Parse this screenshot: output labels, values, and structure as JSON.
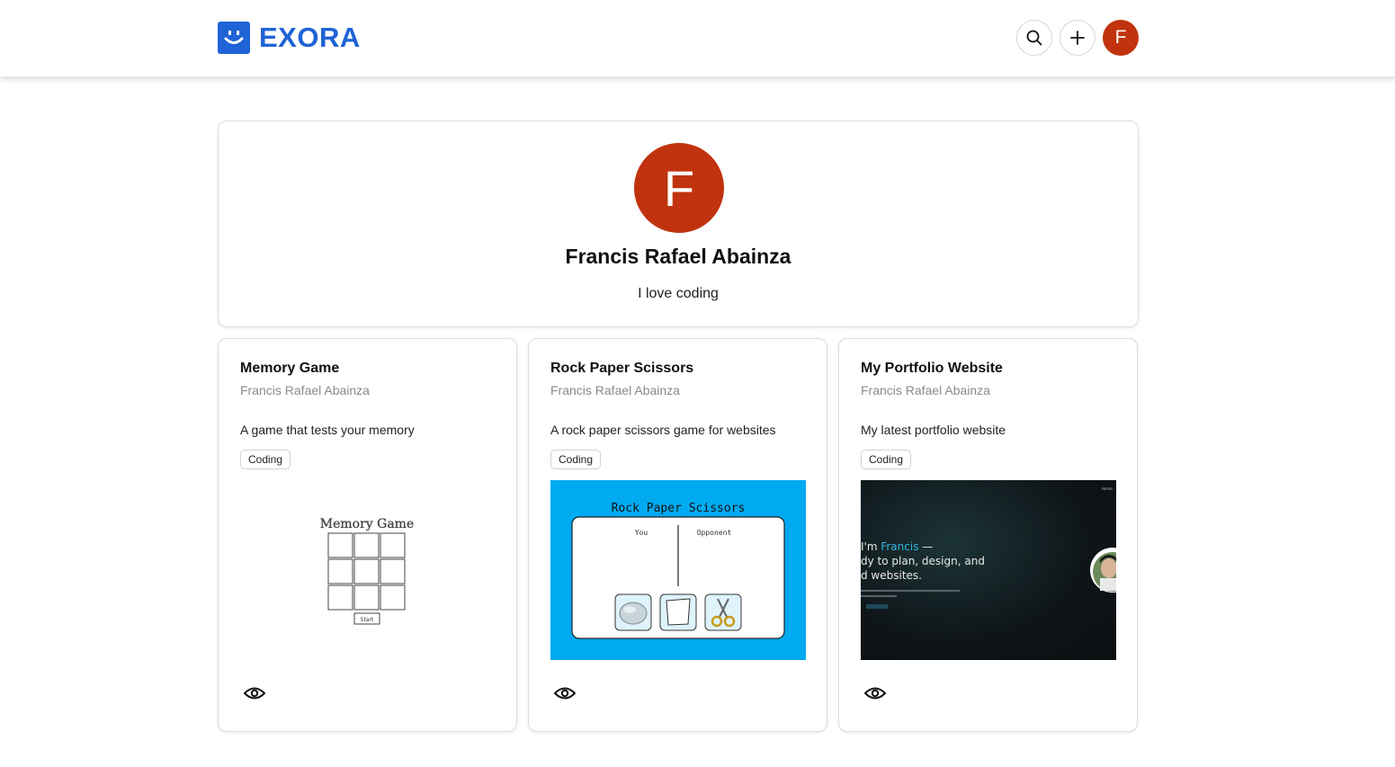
{
  "header": {
    "brand_name": "EXORA",
    "avatar_initial": "F",
    "icons": [
      "smile-logo-icon",
      "search-icon",
      "plus-icon"
    ],
    "brand_color": "#1f63d6",
    "avatar_color": "#c0330e"
  },
  "profile": {
    "initial": "F",
    "name": "Francis Rafael Abainza",
    "bio": "I love coding"
  },
  "projects": [
    {
      "title": "Memory Game",
      "author": "Francis Rafael Abainza",
      "description": "A game that tests your memory",
      "tag": "Coding",
      "thumb": {
        "heading": "Memory Game",
        "button": "Start"
      }
    },
    {
      "title": "Rock Paper Scissors",
      "author": "Francis Rafael Abainza",
      "description": "A rock paper scissors game for websites",
      "tag": "Coding",
      "thumb": {
        "heading": "Rock Paper Scissors",
        "player_label": "You",
        "opponent_label": "Opponent",
        "background": "#00aaf0"
      }
    },
    {
      "title": "My Portfolio Website",
      "author": "Francis Rafael Abainza",
      "description": "My latest portfolio website",
      "tag": "Coding",
      "thumb": {
        "line1_prefix": "I'm ",
        "line1_name": "Francis",
        "line1_suffix": " —",
        "line2": "dy to plan, design, and",
        "line3": "d websites.",
        "nav_item": "Home",
        "background": "#0e1418",
        "accent": "#2fb6e0"
      }
    }
  ]
}
